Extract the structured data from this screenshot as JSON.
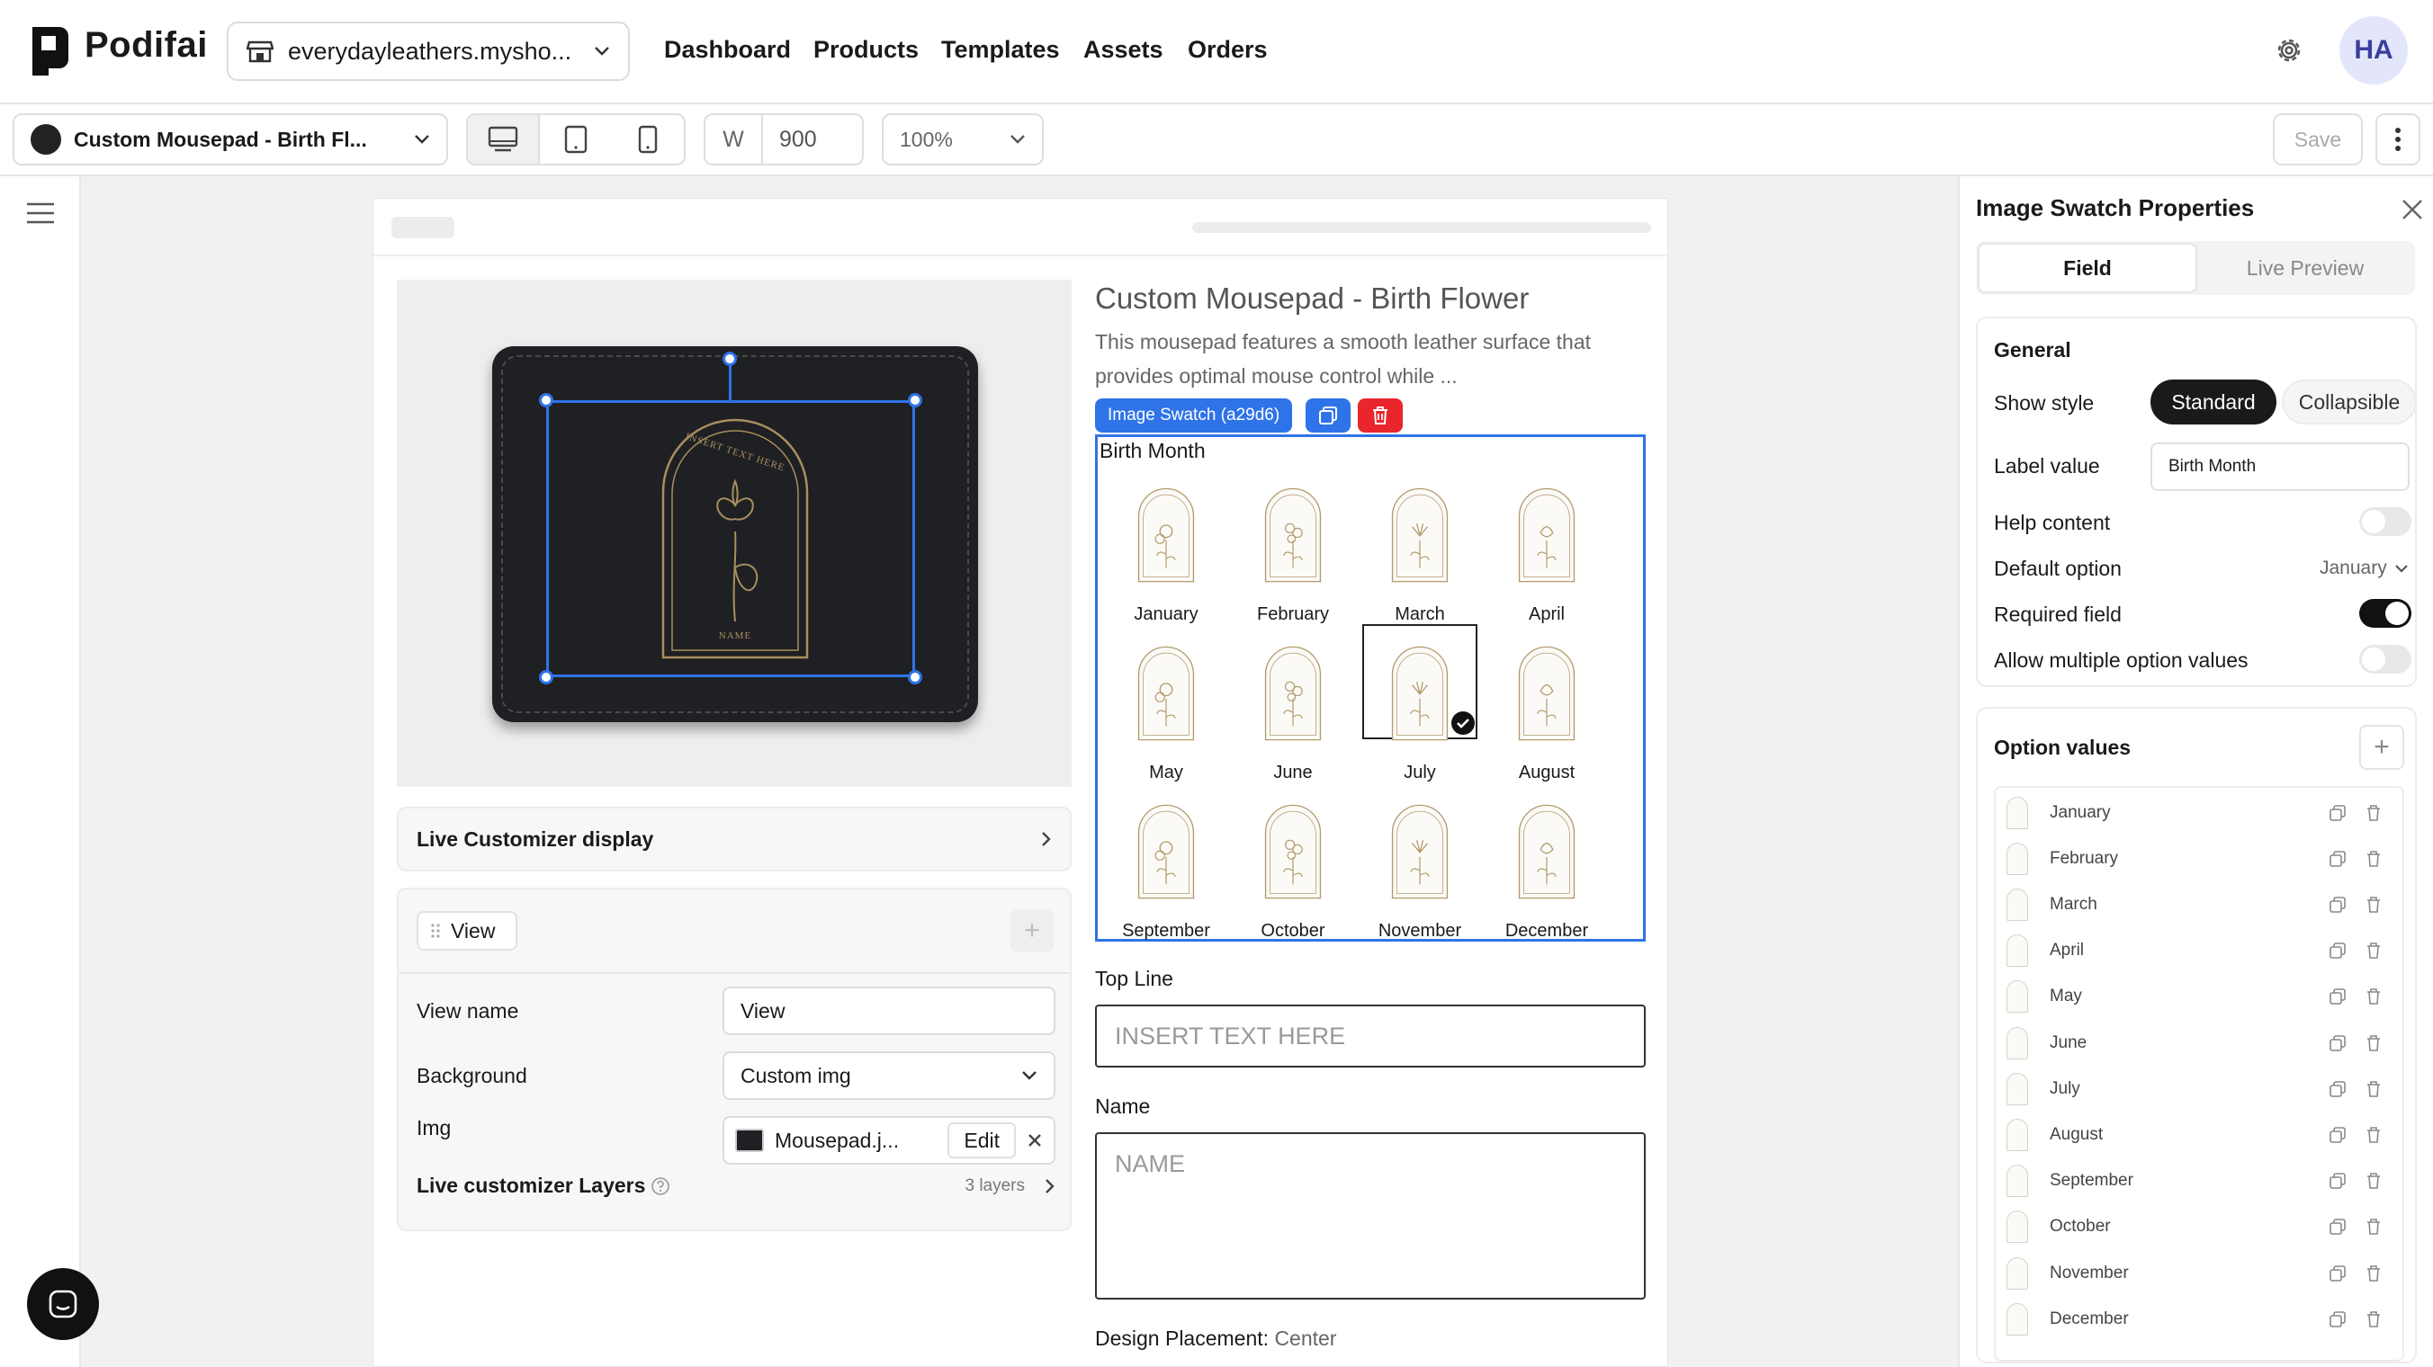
{
  "app": {
    "name": "Podifai"
  },
  "store": {
    "selected": "everydayleathers.mysho..."
  },
  "nav": {
    "items": [
      "Dashboard",
      "Products",
      "Templates",
      "Assets",
      "Orders"
    ]
  },
  "user": {
    "initials": "HA"
  },
  "toolbar": {
    "product": "Custom Mousepad - Birth Fl...",
    "width_label": "W",
    "width_value": "900",
    "zoom": "100%",
    "save_label": "Save"
  },
  "product": {
    "title": "Custom Mousepad - Birth Flower",
    "description": "This mousepad features a smooth leather surface that provides optimal mouse control while ...",
    "image_text_top": "INSERT TEXT HERE",
    "image_text_bottom": "NAME"
  },
  "left_panel": {
    "live_display_label": "Live Customizer display",
    "view_chip": "View",
    "view_name_label": "View name",
    "view_name_value": "View",
    "background_label": "Background",
    "background_value": "Custom img",
    "img_label": "Img",
    "img_file": "Mousepad.j...",
    "img_edit": "Edit",
    "layers_label": "Live customizer Layers",
    "layers_count": "3 layers"
  },
  "swatch": {
    "tag": "Image Swatch (a29d6)",
    "label": "Birth Month",
    "options": [
      "January",
      "February",
      "March",
      "April",
      "May",
      "June",
      "July",
      "August",
      "September",
      "October",
      "November",
      "December"
    ],
    "selected": "July"
  },
  "fields": {
    "top_line_label": "Top Line",
    "top_line_placeholder": "INSERT TEXT HERE",
    "name_label": "Name",
    "name_placeholder": "NAME",
    "design_placement_label": "Design Placement:",
    "design_placement_value": "Center"
  },
  "properties": {
    "title": "Image Swatch Properties",
    "tabs": [
      "Field",
      "Live Preview"
    ],
    "general_heading": "General",
    "show_style_label": "Show style",
    "show_style_options": [
      "Standard",
      "Collapsible"
    ],
    "label_value_label": "Label value",
    "label_value": "Birth Month",
    "help_content_label": "Help content",
    "help_content_on": false,
    "default_option_label": "Default option",
    "default_option_value": "January",
    "required_label": "Required field",
    "required_on": true,
    "allow_multiple_label": "Allow multiple option values",
    "allow_multiple_on": false,
    "option_values_heading": "Option values",
    "option_values": [
      "January",
      "February",
      "March",
      "April",
      "May",
      "June",
      "July",
      "August",
      "September",
      "October",
      "November",
      "December"
    ]
  },
  "colors": {
    "accent": "#2f73e8",
    "danger": "#e8262c",
    "dark": "#1a1a1a",
    "flower_gold": "#b39a6a"
  }
}
